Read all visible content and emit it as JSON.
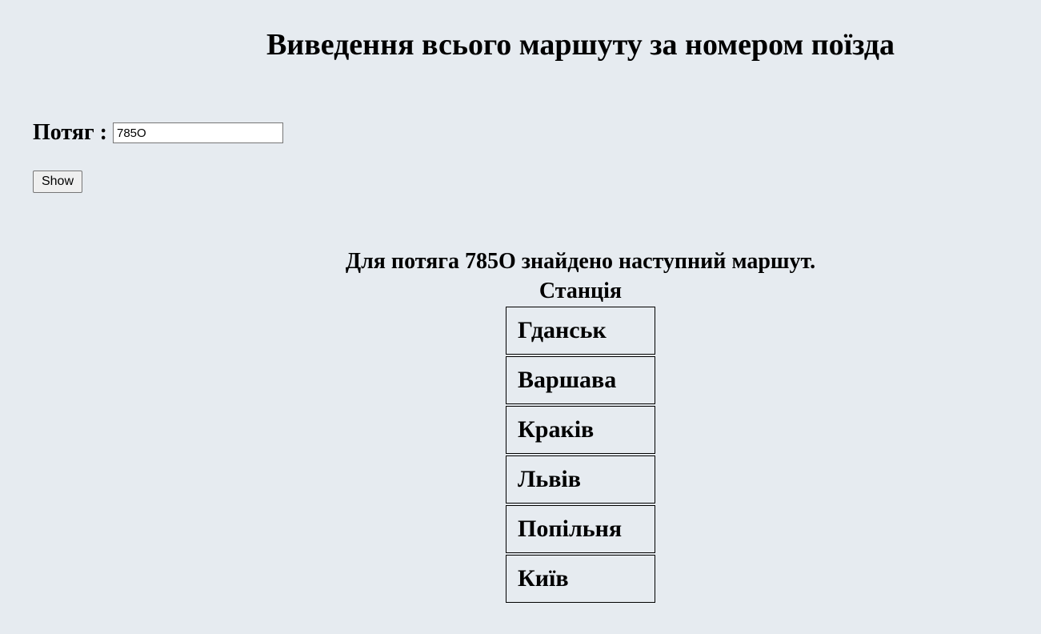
{
  "page": {
    "title": "Виведення всього маршуту за номером поїзда"
  },
  "form": {
    "train_label": "Потяг :",
    "train_value": "785O",
    "show_label": "Show"
  },
  "result": {
    "message": "Для потяга 785O знайдено наступний маршут.",
    "column_header": "Станція",
    "stations": [
      "Гданськ",
      "Варшава",
      "Краків",
      "Львів",
      "Попільня",
      "Київ"
    ]
  }
}
